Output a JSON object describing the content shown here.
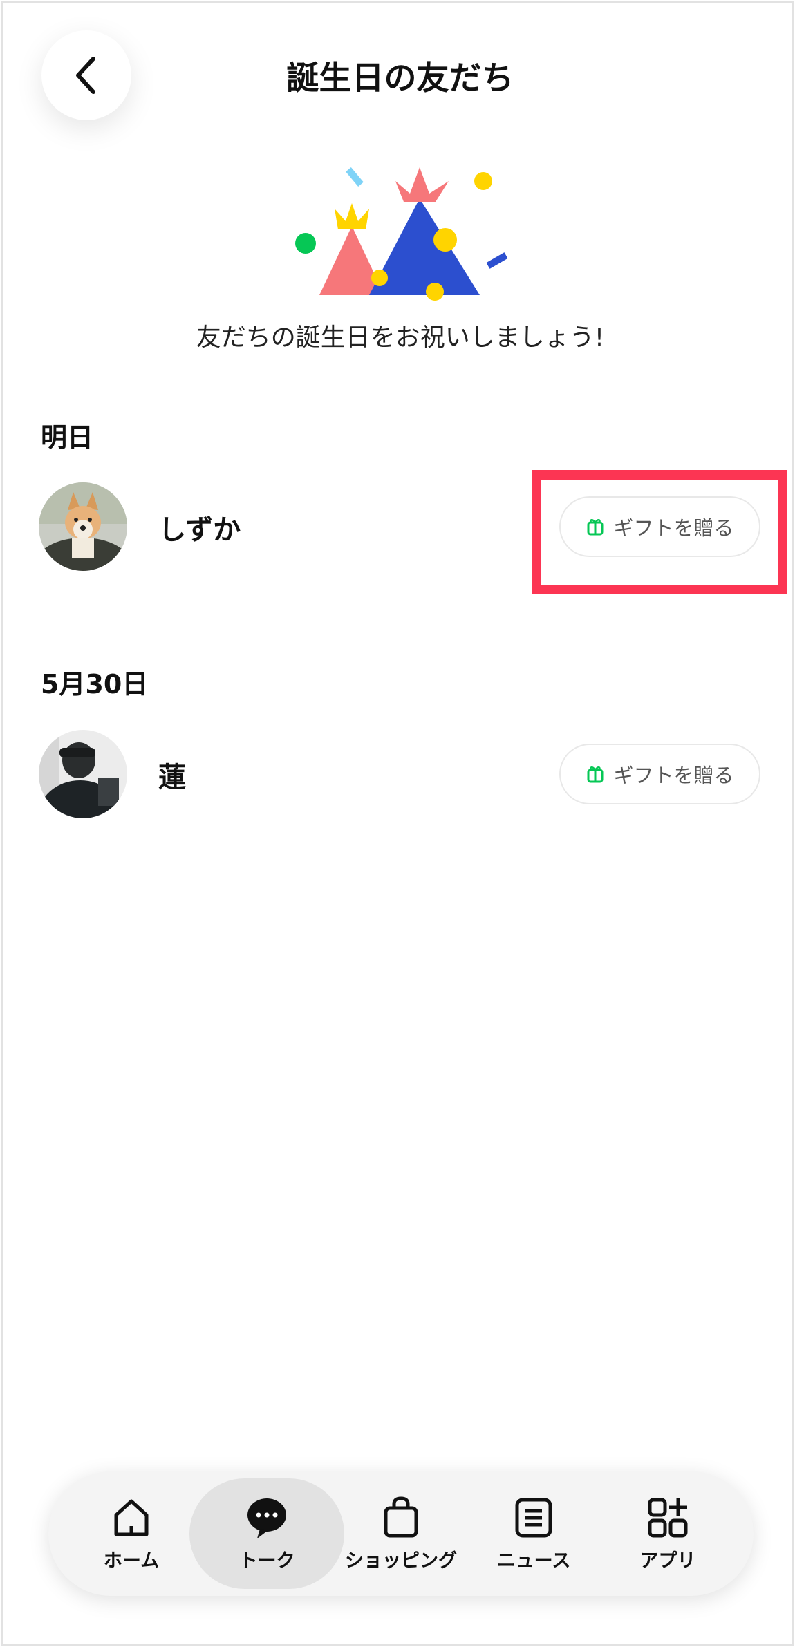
{
  "header": {
    "title": "誕生日の友だち"
  },
  "hero": {
    "message": "友だちの誕生日をお祝いしましょう!"
  },
  "sections": [
    {
      "label": "明日",
      "friends": [
        {
          "name": "しずか",
          "gift_label": "ギフトを贈る"
        }
      ]
    },
    {
      "label": "5月30日",
      "friends": [
        {
          "name": "蓮",
          "gift_label": "ギフトを贈る"
        }
      ]
    }
  ],
  "tabbar": {
    "items": [
      {
        "label": "ホーム",
        "icon": "home-icon"
      },
      {
        "label": "トーク",
        "icon": "chat-bubble-icon",
        "active": true
      },
      {
        "label": "ショッピング",
        "icon": "shopping-bag-icon"
      },
      {
        "label": "ニュース",
        "icon": "news-icon"
      },
      {
        "label": "アプリ",
        "icon": "apps-icon"
      }
    ]
  },
  "colors": {
    "highlight": "#fc3553",
    "gift_icon": "#06c755",
    "active_tab_bg": "#e2e2e2"
  }
}
